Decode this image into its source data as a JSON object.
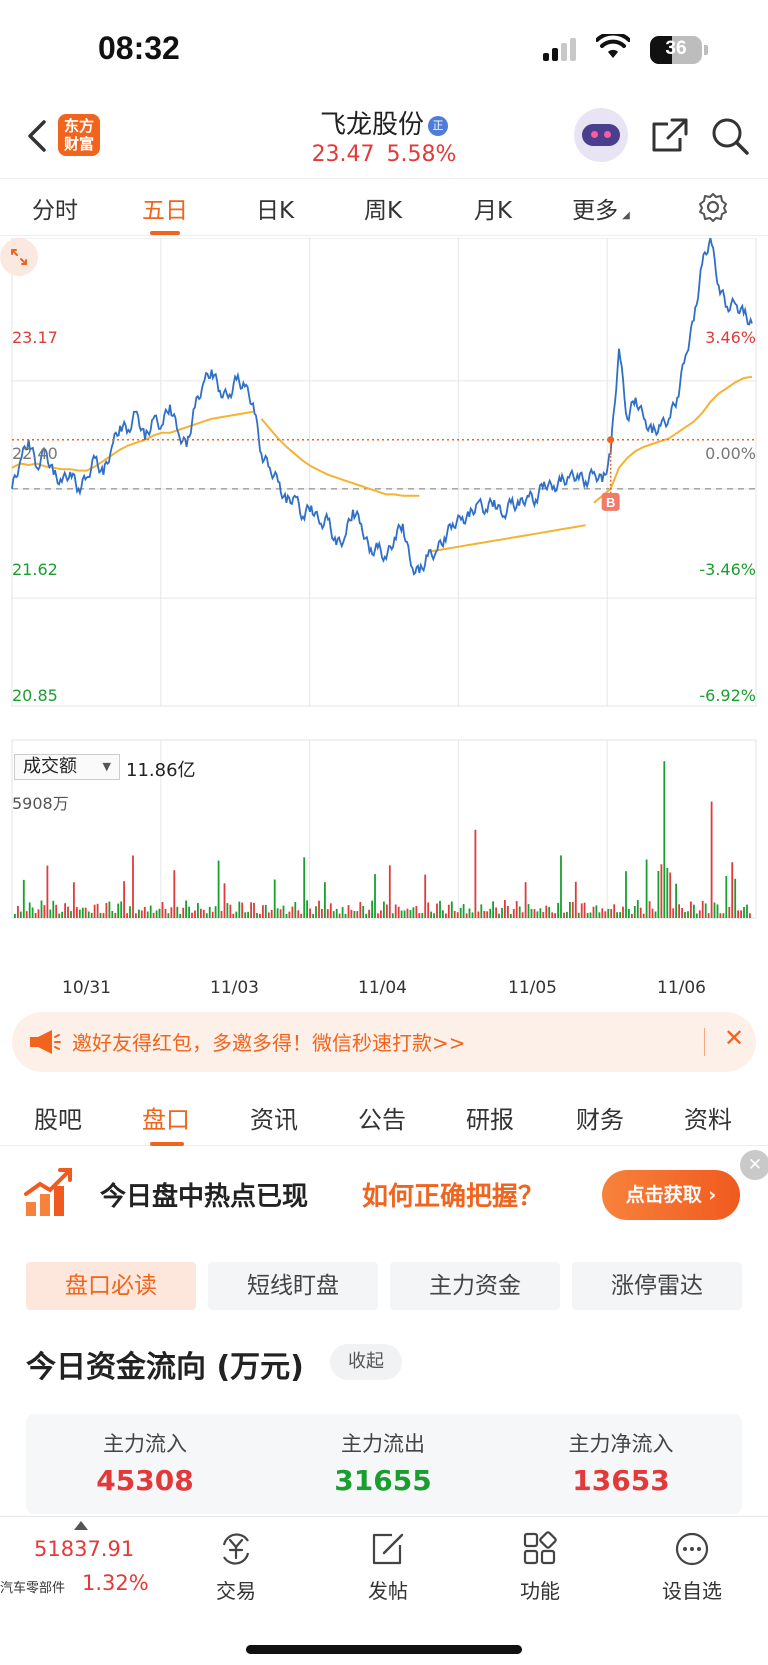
{
  "status_bar": {
    "time": "08:32",
    "battery": "36"
  },
  "header": {
    "logo_text": "东方财富",
    "stock_name": "飞龙股份",
    "badge": "正",
    "price": "23.47",
    "change_pct": "5.58%"
  },
  "chart_tabs": [
    "分时",
    "五日",
    "日K",
    "周K",
    "月K",
    "更多"
  ],
  "active_chart_tab": "五日",
  "chart_data": {
    "type": "line",
    "x_dates": [
      "10/31",
      "11/03",
      "11/04",
      "11/05",
      "11/06"
    ],
    "y_labels_left": [
      "23.17",
      "22.40",
      "21.62",
      "20.85"
    ],
    "y_labels_right": [
      "3.46%",
      "0.00%",
      "-3.46%",
      "-6.92%"
    ],
    "ylim": [
      20.85,
      24.19
    ],
    "prev_close": 22.4,
    "series": [
      {
        "values": [
          22.4,
          22.6,
          22.75,
          22.55,
          22.68,
          22.5,
          22.45,
          22.52,
          22.4,
          22.48,
          22.62,
          22.5,
          22.7,
          22.85,
          22.82,
          22.95,
          22.75,
          22.9,
          22.85,
          23.0,
          22.8,
          22.7,
          22.98,
          23.15,
          23.25,
          23.1,
          23.05,
          23.18,
          23.13,
          23.01,
          22.65,
          22.55,
          22.45,
          22.3,
          22.35,
          22.2,
          22.28,
          22.15,
          22.18,
          22.0,
          22.05,
          22.25,
          22.15,
          21.95,
          21.98,
          21.9,
          22.05,
          22.15,
          21.85,
          21.8,
          21.92,
          21.95,
          22.05,
          22.15,
          22.18,
          22.2,
          22.3,
          22.25,
          22.32,
          22.2,
          22.3,
          22.28,
          22.35,
          22.32,
          22.45,
          22.4,
          22.45,
          22.48,
          22.5,
          22.45,
          22.52,
          22.45,
          22.65,
          23.4,
          22.9,
          23.05,
          22.9,
          22.8,
          22.85,
          22.9,
          23.05,
          23.35,
          23.6,
          24.0,
          24.19,
          23.85,
          23.7,
          23.72,
          23.65,
          23.58
        ]
      },
      {
        "values": [
          22.55,
          22.58,
          22.57,
          22.58,
          22.56,
          22.55,
          22.54,
          22.54,
          22.53,
          22.53,
          22.56,
          22.6,
          22.64,
          22.68,
          22.71,
          22.73,
          22.75,
          22.78,
          22.8,
          22.8,
          22.82,
          22.84,
          22.86,
          22.88,
          22.9,
          22.91,
          22.92,
          22.93,
          22.94,
          22.95,
          22.9,
          22.83,
          22.76,
          22.7,
          22.65,
          22.6,
          22.56,
          22.53,
          22.5,
          22.48,
          22.46,
          22.44,
          22.42,
          22.4,
          22.38,
          22.36,
          22.36,
          22.35,
          22.35,
          22.35,
          21.95,
          21.96,
          21.97,
          21.98,
          21.99,
          22.0,
          22.01,
          22.02,
          22.03,
          22.04,
          22.05,
          22.06,
          22.07,
          22.08,
          22.09,
          22.1,
          22.11,
          22.12,
          22.13,
          22.14,
          22.3,
          22.35,
          22.4,
          22.55,
          22.62,
          22.67,
          22.7,
          22.72,
          22.74,
          22.76,
          22.8,
          22.84,
          22.88,
          22.94,
          23.02,
          23.08,
          23.12,
          23.16,
          23.19,
          23.2
        ]
      }
    ],
    "buy_marker": "B",
    "volume_select": "成交额",
    "volume_total": "11.86亿",
    "volume_max_label": "5908万"
  },
  "banner": {
    "text": "邀好友得红包，多邀多得！微信秒速打款>>"
  },
  "lower_tabs": [
    "股吧",
    "盘口",
    "资讯",
    "公告",
    "研报",
    "财务",
    "资料"
  ],
  "active_lower_tab": "盘口",
  "promo": {
    "text_black": "今日盘中热点已现",
    "text_orange": "如何正确把握？",
    "button": "点击获取"
  },
  "pills": [
    "盘口必读",
    "短线盯盘",
    "主力资金",
    "涨停雷达"
  ],
  "flow": {
    "title": "今日资金流向 (万元)",
    "collapse": "收起",
    "items": [
      {
        "label": "主力流入",
        "value": "45308"
      },
      {
        "label": "主力流出",
        "value": "31655"
      },
      {
        "label": "主力净流入",
        "value": "13653"
      }
    ]
  },
  "bottom_bar": {
    "index_value": "51837.91",
    "index_name": "汽车零部件",
    "index_pct": "1.32%",
    "nav": [
      "交易",
      "发帖",
      "功能",
      "设自选"
    ]
  },
  "colors": {
    "accent": "#f0641e",
    "up": "#e23a3a",
    "down": "#1a9e2f",
    "price_line": "#2f6fc8",
    "avg_line": "#f5b233"
  }
}
